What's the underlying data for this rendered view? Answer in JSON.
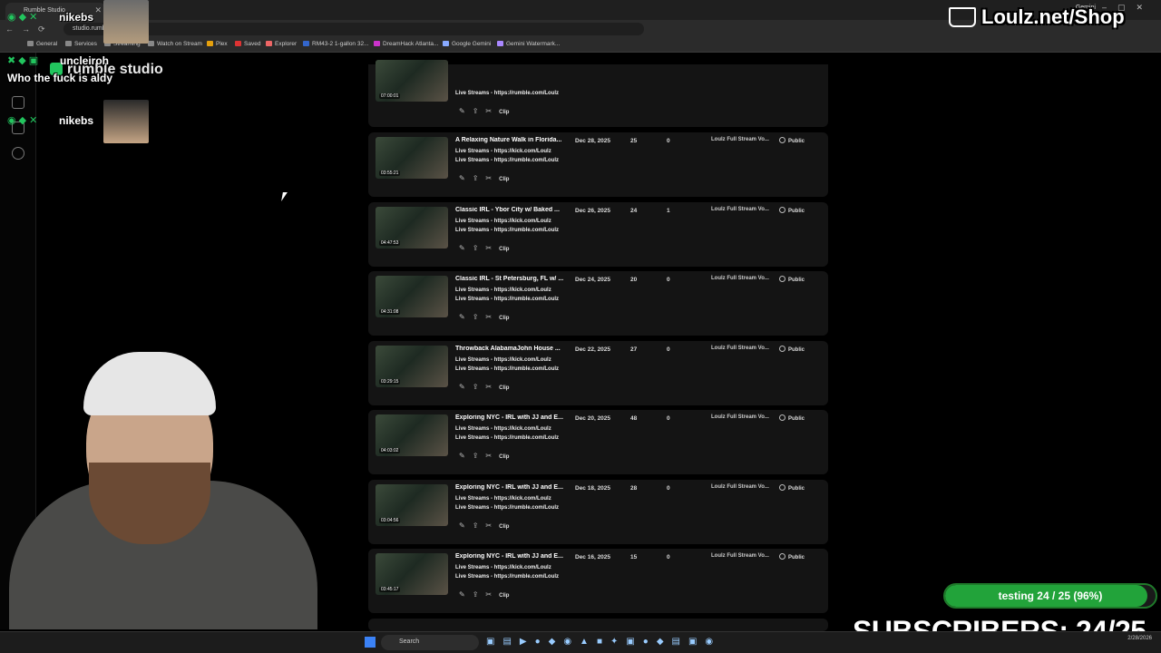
{
  "browser": {
    "tab_title": "Rumble Studio",
    "url": "studio.rumble.com",
    "gemini_label": "Gemini",
    "bookmarks": [
      "General",
      "Services",
      "Streaming",
      "Watch on Stream",
      "Plex",
      "Saved",
      "Explorer",
      "RM43-2 1-gallon 32...",
      "DreamHack Atlanta...",
      "Google Gemini",
      "Gemini Watermark..."
    ]
  },
  "app": {
    "logo_text": "rumble studio"
  },
  "chat": [
    {
      "user": "uncleiroh",
      "message": "Who the fuck is aldy"
    },
    {
      "user": "nikebs",
      "message": ""
    },
    {
      "user": "nikebs",
      "message": ""
    }
  ],
  "overlay": {
    "shop_banner": "Loulz.net/Shop",
    "progress_text": "testing 24 / 25 (96%)",
    "progress_fraction": 0.96,
    "subscribers_text": "SUBSCRIBERS: 24/25"
  },
  "videos": [
    {
      "title": "",
      "date": "",
      "views": "",
      "comments": "",
      "playlist": "",
      "visibility": "",
      "duration": "07:00:01",
      "desc1": "Live Streams - https://rumble.com/Loulz",
      "desc2": ""
    },
    {
      "title": "A Relaxing Nature Walk in Florida...",
      "date": "Dec 28, 2025",
      "views": "25",
      "comments": "0",
      "playlist": "Loulz Full Stream Vo...",
      "visibility": "Public",
      "duration": "03:55:21",
      "desc1": "Live Streams - https://kick.com/Loulz",
      "desc2": "Live Streams - https://rumble.com/Loulz"
    },
    {
      "title": "Classic IRL - Ybor City w/ Baked ...",
      "date": "Dec 26, 2025",
      "views": "24",
      "comments": "1",
      "playlist": "Loulz Full Stream Vo...",
      "visibility": "Public",
      "duration": "04:47:53",
      "desc1": "Live Streams - https://kick.com/Loulz",
      "desc2": "Live Streams - https://rumble.com/Loulz"
    },
    {
      "title": "Classic IRL - St Petersburg, FL w/ ...",
      "date": "Dec 24, 2025",
      "views": "20",
      "comments": "0",
      "playlist": "Loulz Full Stream Vo...",
      "visibility": "Public",
      "duration": "04:31:08",
      "desc1": "Live Streams - https://kick.com/Loulz",
      "desc2": "Live Streams - https://rumble.com/Loulz"
    },
    {
      "title": "Throwback AlabamaJohn House ...",
      "date": "Dec 22, 2025",
      "views": "27",
      "comments": "0",
      "playlist": "Loulz Full Stream Vo...",
      "visibility": "Public",
      "duration": "03:29:15",
      "desc1": "Live Streams - https://kick.com/Loulz",
      "desc2": "Live Streams - https://rumble.com/Loulz"
    },
    {
      "title": "Exploring NYC - IRL with JJ and E...",
      "date": "Dec 20, 2025",
      "views": "48",
      "comments": "0",
      "playlist": "Loulz Full Stream Vo...",
      "visibility": "Public",
      "duration": "04:03:02",
      "desc1": "Live Streams - https://kick.com/Loulz",
      "desc2": "Live Streams - https://rumble.com/Loulz"
    },
    {
      "title": "Exploring NYC - IRL with JJ and E...",
      "date": "Dec 18, 2025",
      "views": "28",
      "comments": "0",
      "playlist": "Loulz Full Stream Vo...",
      "visibility": "Public",
      "duration": "03:04:56",
      "desc1": "Live Streams - https://kick.com/Loulz",
      "desc2": "Live Streams - https://rumble.com/Loulz"
    },
    {
      "title": "Exploring NYC - IRL with JJ and E...",
      "date": "Dec 16, 2025",
      "views": "15",
      "comments": "0",
      "playlist": "Loulz Full Stream Vo...",
      "visibility": "Public",
      "duration": "03:45:17",
      "desc1": "Live Streams - https://kick.com/Loulz",
      "desc2": "Live Streams - https://rumble.com/Loulz"
    }
  ],
  "row_actions": {
    "clip_label": "Clip"
  },
  "taskbar": {
    "search_placeholder": "Search",
    "date": "2/28/2026"
  },
  "colors": {
    "accent_green": "#22c55e",
    "progress_green": "#22a33a",
    "row_bg": "#141414"
  },
  "icons": [
    "edit-icon",
    "share-icon",
    "scissors-icon",
    "globe-icon",
    "gear-icon",
    "cart-icon",
    "windows-start-icon"
  ]
}
